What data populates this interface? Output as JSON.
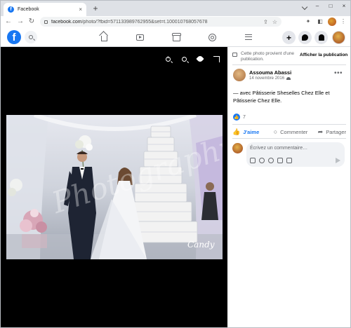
{
  "browser": {
    "tab_title": "Facebook",
    "tab_close": "×",
    "new_tab": "+",
    "url_host": "facebook.com",
    "url_path": "/photo/?fbid=571133989762955&set=t.100010768057678",
    "window_minimize": "–",
    "window_maximize": "□",
    "window_close": "×",
    "back": "←",
    "forward": "→",
    "reload": "↻",
    "bookmark": "☆",
    "share": "⇪",
    "extensions": "✦",
    "sidepanel": "◧",
    "menu": "⋮"
  },
  "fb_header": {
    "logo": "f",
    "create": "+"
  },
  "notice": {
    "text": "Cette photo provient d'une publication.",
    "link": "Afficher la publication"
  },
  "post": {
    "author": "Assouma Abassi",
    "date": "14 novembre 2016",
    "more": "•••",
    "caption": "— avec Pâtisserie Sheselles Chez Elle et Pâtisserie Chez Elle.",
    "reaction_count": "7"
  },
  "actions": {
    "like": "J'aime",
    "comment": "Commenter",
    "share": "Partager"
  },
  "comment": {
    "placeholder": "Écrivez un commentaire…"
  },
  "photo_watermark": {
    "brand": "Candy"
  }
}
